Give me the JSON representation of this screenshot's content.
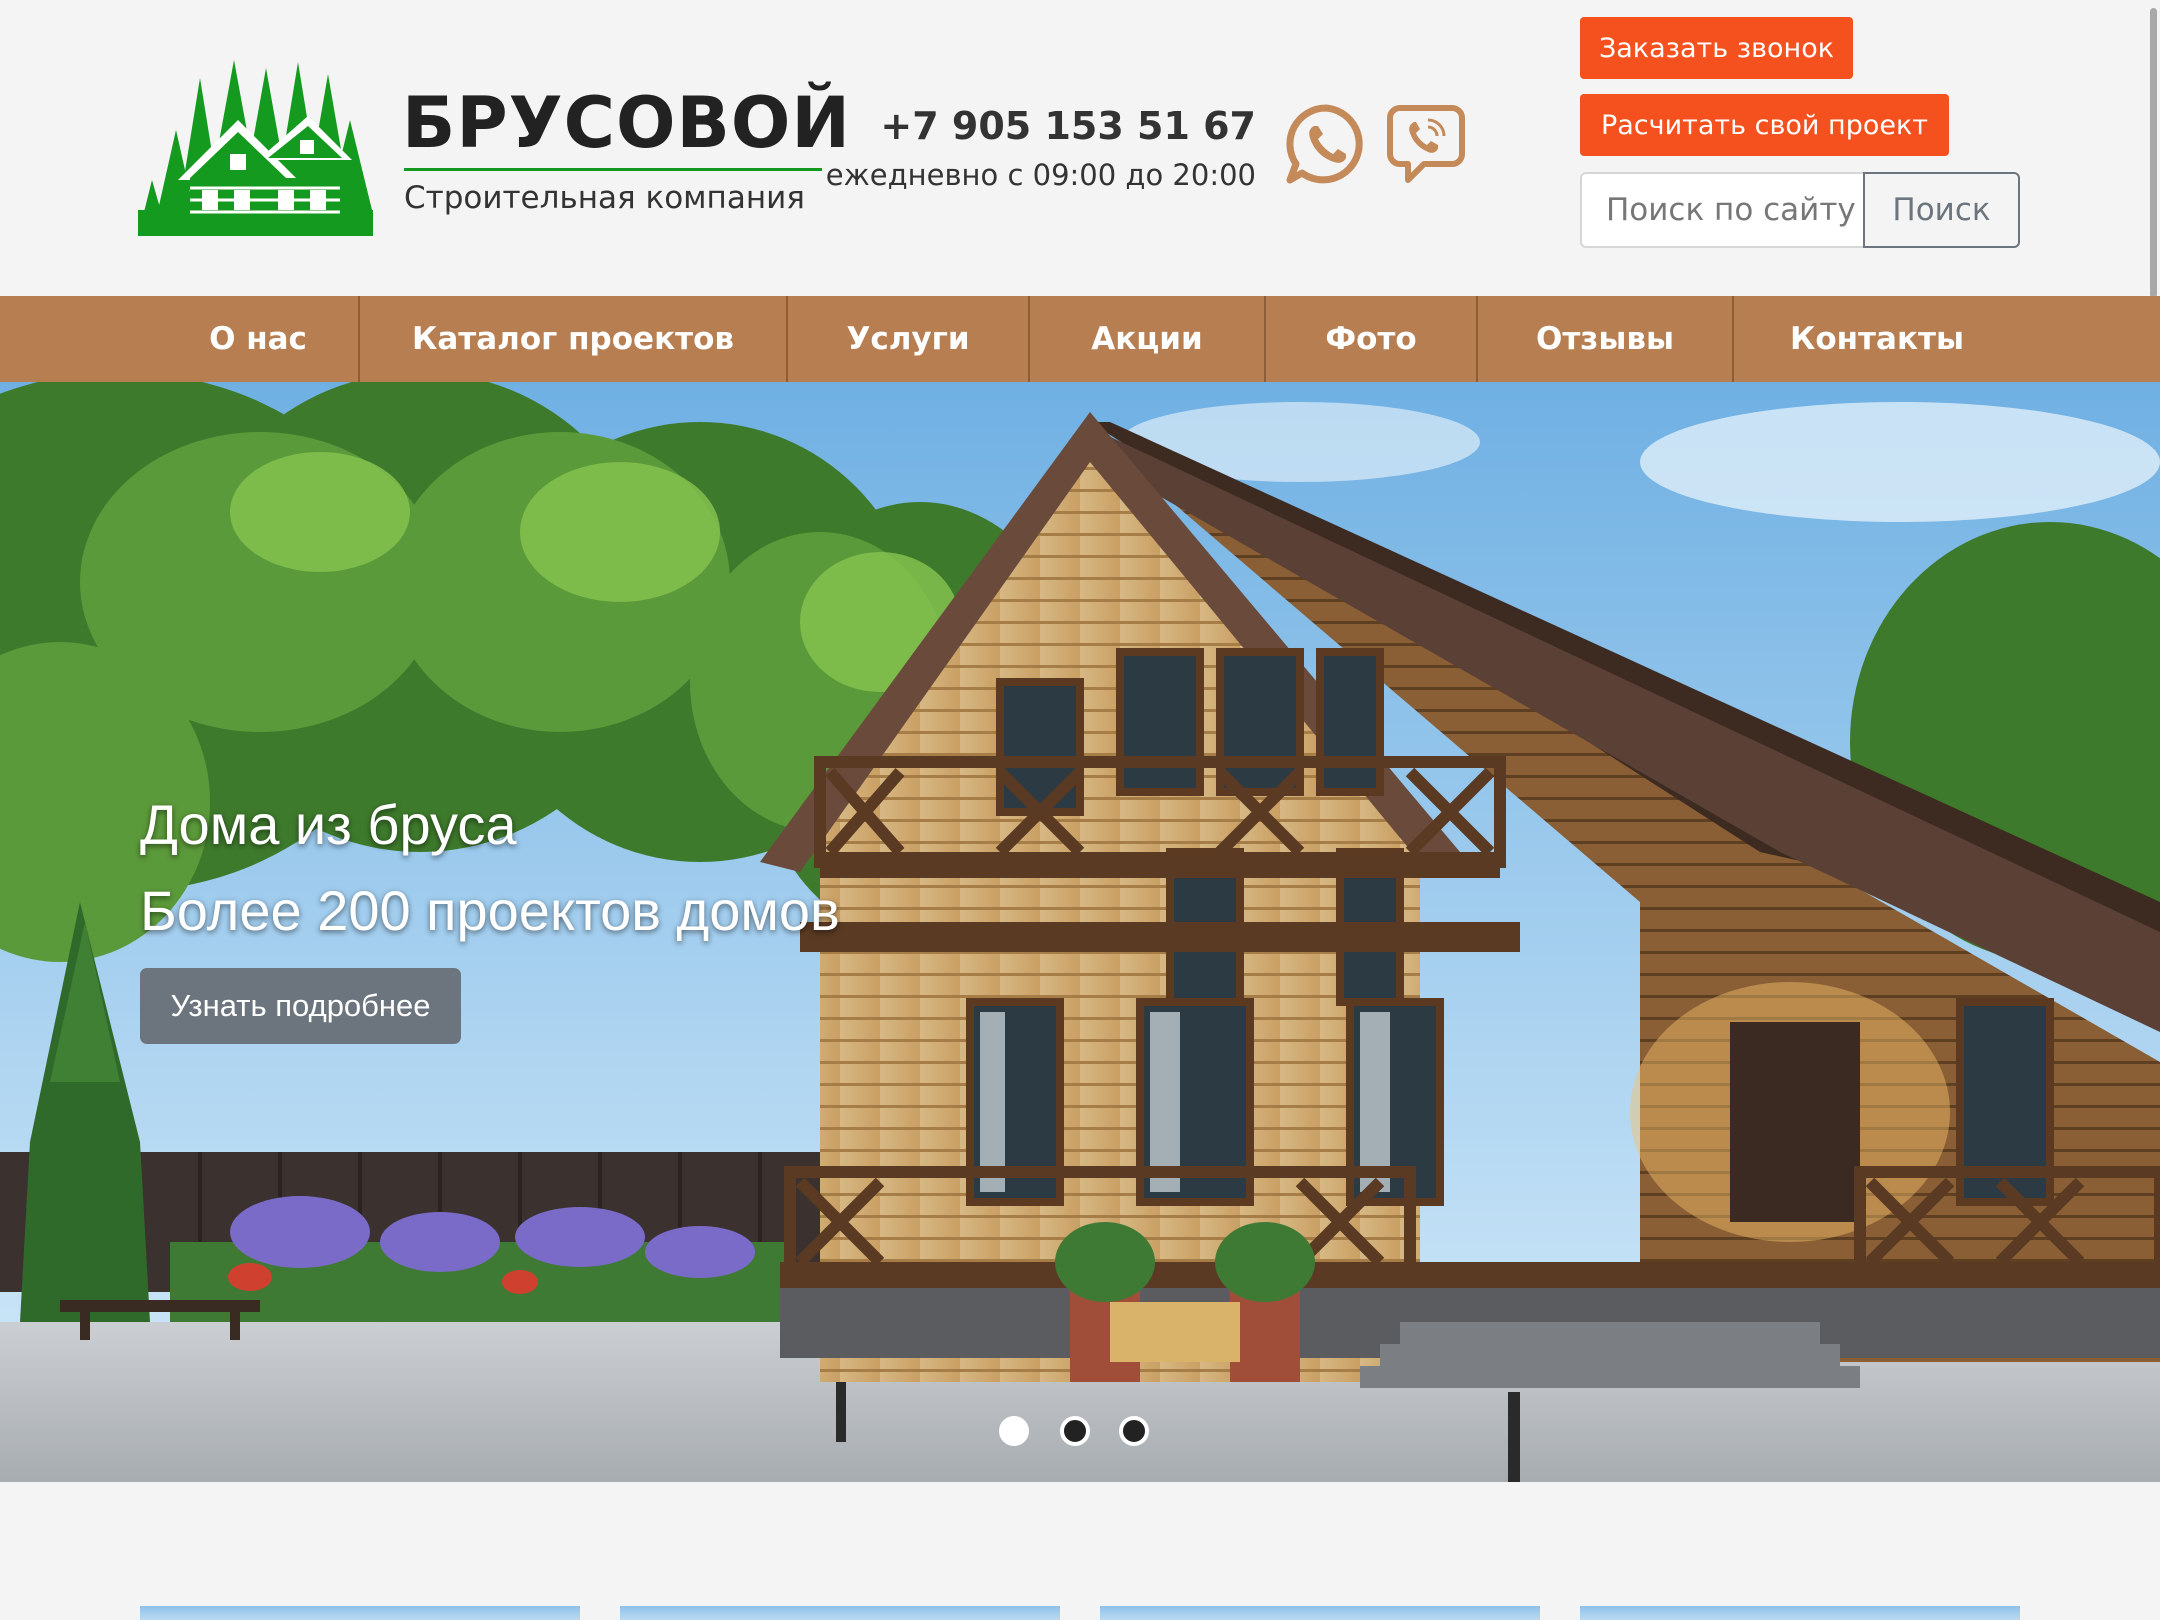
{
  "brand": {
    "name": "БРУСОВОЙ",
    "tagline": "Строительная компания",
    "colors": {
      "logo_green": "#149a1e",
      "accent_orange": "#f5511f",
      "nav_brown": "#b67e51",
      "icon_brown": "#c48a5a"
    }
  },
  "contact": {
    "phone": "+7 905 153 51 67",
    "hours": "ежедневно с 09:00 до 20:00",
    "messengers": [
      {
        "name": "WhatsApp",
        "icon": "whatsapp-icon"
      },
      {
        "name": "Viber",
        "icon": "viber-icon"
      }
    ]
  },
  "actions": {
    "call_label": "Заказать звонок",
    "calc_label": "Расчитать свой проект"
  },
  "search": {
    "placeholder": "Поиск по сайту",
    "button_label": "Поиск"
  },
  "nav": {
    "items": [
      {
        "label": "О нас"
      },
      {
        "label": "Каталог проектов"
      },
      {
        "label": "Услуги"
      },
      {
        "label": "Акции"
      },
      {
        "label": "Фото"
      },
      {
        "label": "Отзывы"
      },
      {
        "label": "Контакты"
      }
    ]
  },
  "hero": {
    "title": "Дома из бруса",
    "subtitle": "Более 200 проектов домов",
    "button_label": "Узнать подробнее",
    "slides_total": 3,
    "active_slide": 1
  }
}
